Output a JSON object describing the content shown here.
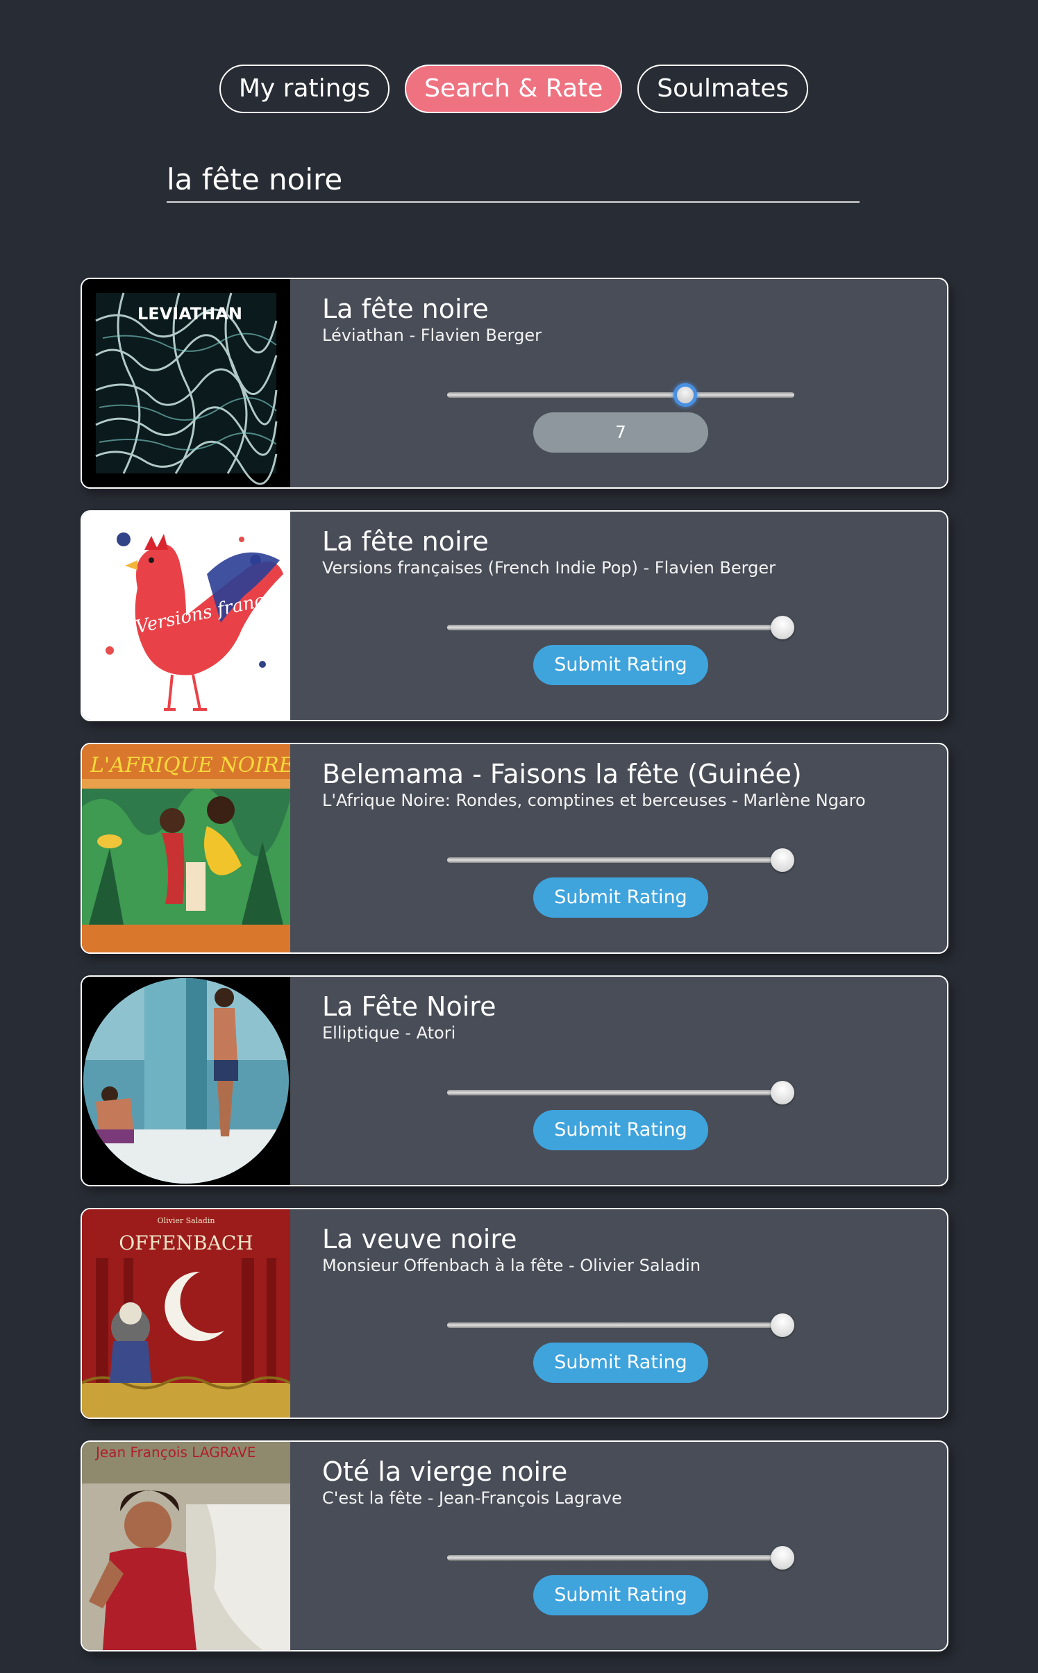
{
  "tabs": [
    {
      "label": "My ratings",
      "active": false
    },
    {
      "label": "Search & Rate",
      "active": true
    },
    {
      "label": "Soulmates",
      "active": false
    }
  ],
  "search": {
    "value": "la fête noire"
  },
  "results": [
    {
      "title": "La fête noire",
      "subtitle": "Léviathan - Flavien Berger",
      "art_text": "LEVIATHAN",
      "rating_fraction": 0.7,
      "rated_value": "7",
      "action_label": null
    },
    {
      "title": "La fête noire",
      "subtitle": "Versions françaises (French Indie Pop) - Flavien Berger",
      "art_text": "Versions françaises",
      "rating_fraction": 1.0,
      "rated_value": null,
      "action_label": "Submit Rating"
    },
    {
      "title": "Belemama - Faisons la fête (Guinée)",
      "subtitle": "L'Afrique Noire: Rondes, comptines et berceuses - Marlène Ngaro",
      "art_text": "L'AFRIQUE NOIRE",
      "rating_fraction": 1.0,
      "rated_value": null,
      "action_label": "Submit Rating"
    },
    {
      "title": "La Fête Noire",
      "subtitle": "Elliptique - Atori",
      "art_text": "",
      "rating_fraction": 1.0,
      "rated_value": null,
      "action_label": "Submit Rating"
    },
    {
      "title": "La veuve noire",
      "subtitle": "Monsieur Offenbach à la fête - Olivier Saladin",
      "art_text": "OFFENBACH",
      "rating_fraction": 1.0,
      "rated_value": null,
      "action_label": "Submit Rating"
    },
    {
      "title": "Oté la vierge noire",
      "subtitle": "C'est la fête - Jean-François Lagrave",
      "art_text": "Jean François LAGRAVE",
      "rating_fraction": 1.0,
      "rated_value": null,
      "action_label": "Submit Rating"
    }
  ],
  "colors": {
    "background": "#282c34",
    "card": "#484d57",
    "active_tab": "#ef7281",
    "submit_button": "#3fa3dc",
    "rated_pill": "#8d979d",
    "slider_focus": "#4a90e2"
  }
}
